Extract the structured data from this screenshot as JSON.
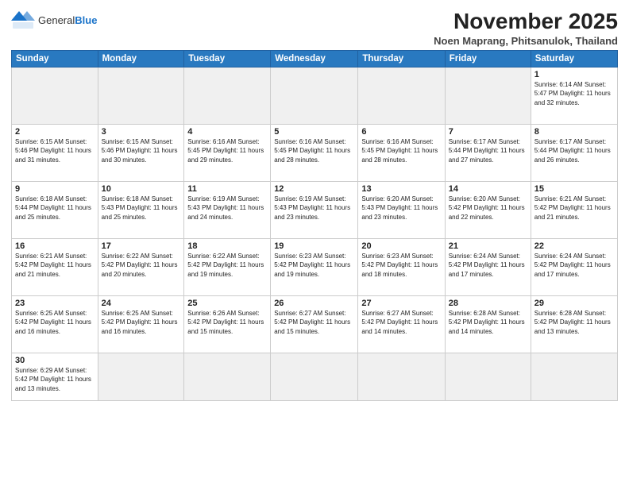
{
  "header": {
    "logo_general": "General",
    "logo_blue": "Blue",
    "month_title": "November 2025",
    "location": "Noen Maprang, Phitsanulok, Thailand"
  },
  "weekdays": [
    "Sunday",
    "Monday",
    "Tuesday",
    "Wednesday",
    "Thursday",
    "Friday",
    "Saturday"
  ],
  "weeks": [
    [
      {
        "day": "",
        "info": ""
      },
      {
        "day": "",
        "info": ""
      },
      {
        "day": "",
        "info": ""
      },
      {
        "day": "",
        "info": ""
      },
      {
        "day": "",
        "info": ""
      },
      {
        "day": "",
        "info": ""
      },
      {
        "day": "1",
        "info": "Sunrise: 6:14 AM\nSunset: 5:47 PM\nDaylight: 11 hours\nand 32 minutes."
      }
    ],
    [
      {
        "day": "2",
        "info": "Sunrise: 6:15 AM\nSunset: 5:46 PM\nDaylight: 11 hours\nand 31 minutes."
      },
      {
        "day": "3",
        "info": "Sunrise: 6:15 AM\nSunset: 5:46 PM\nDaylight: 11 hours\nand 30 minutes."
      },
      {
        "day": "4",
        "info": "Sunrise: 6:16 AM\nSunset: 5:45 PM\nDaylight: 11 hours\nand 29 minutes."
      },
      {
        "day": "5",
        "info": "Sunrise: 6:16 AM\nSunset: 5:45 PM\nDaylight: 11 hours\nand 28 minutes."
      },
      {
        "day": "6",
        "info": "Sunrise: 6:16 AM\nSunset: 5:45 PM\nDaylight: 11 hours\nand 28 minutes."
      },
      {
        "day": "7",
        "info": "Sunrise: 6:17 AM\nSunset: 5:44 PM\nDaylight: 11 hours\nand 27 minutes."
      },
      {
        "day": "8",
        "info": "Sunrise: 6:17 AM\nSunset: 5:44 PM\nDaylight: 11 hours\nand 26 minutes."
      }
    ],
    [
      {
        "day": "9",
        "info": "Sunrise: 6:18 AM\nSunset: 5:44 PM\nDaylight: 11 hours\nand 25 minutes."
      },
      {
        "day": "10",
        "info": "Sunrise: 6:18 AM\nSunset: 5:43 PM\nDaylight: 11 hours\nand 25 minutes."
      },
      {
        "day": "11",
        "info": "Sunrise: 6:19 AM\nSunset: 5:43 PM\nDaylight: 11 hours\nand 24 minutes."
      },
      {
        "day": "12",
        "info": "Sunrise: 6:19 AM\nSunset: 5:43 PM\nDaylight: 11 hours\nand 23 minutes."
      },
      {
        "day": "13",
        "info": "Sunrise: 6:20 AM\nSunset: 5:43 PM\nDaylight: 11 hours\nand 23 minutes."
      },
      {
        "day": "14",
        "info": "Sunrise: 6:20 AM\nSunset: 5:42 PM\nDaylight: 11 hours\nand 22 minutes."
      },
      {
        "day": "15",
        "info": "Sunrise: 6:21 AM\nSunset: 5:42 PM\nDaylight: 11 hours\nand 21 minutes."
      }
    ],
    [
      {
        "day": "16",
        "info": "Sunrise: 6:21 AM\nSunset: 5:42 PM\nDaylight: 11 hours\nand 21 minutes."
      },
      {
        "day": "17",
        "info": "Sunrise: 6:22 AM\nSunset: 5:42 PM\nDaylight: 11 hours\nand 20 minutes."
      },
      {
        "day": "18",
        "info": "Sunrise: 6:22 AM\nSunset: 5:42 PM\nDaylight: 11 hours\nand 19 minutes."
      },
      {
        "day": "19",
        "info": "Sunrise: 6:23 AM\nSunset: 5:42 PM\nDaylight: 11 hours\nand 19 minutes."
      },
      {
        "day": "20",
        "info": "Sunrise: 6:23 AM\nSunset: 5:42 PM\nDaylight: 11 hours\nand 18 minutes."
      },
      {
        "day": "21",
        "info": "Sunrise: 6:24 AM\nSunset: 5:42 PM\nDaylight: 11 hours\nand 17 minutes."
      },
      {
        "day": "22",
        "info": "Sunrise: 6:24 AM\nSunset: 5:42 PM\nDaylight: 11 hours\nand 17 minutes."
      }
    ],
    [
      {
        "day": "23",
        "info": "Sunrise: 6:25 AM\nSunset: 5:42 PM\nDaylight: 11 hours\nand 16 minutes."
      },
      {
        "day": "24",
        "info": "Sunrise: 6:25 AM\nSunset: 5:42 PM\nDaylight: 11 hours\nand 16 minutes."
      },
      {
        "day": "25",
        "info": "Sunrise: 6:26 AM\nSunset: 5:42 PM\nDaylight: 11 hours\nand 15 minutes."
      },
      {
        "day": "26",
        "info": "Sunrise: 6:27 AM\nSunset: 5:42 PM\nDaylight: 11 hours\nand 15 minutes."
      },
      {
        "day": "27",
        "info": "Sunrise: 6:27 AM\nSunset: 5:42 PM\nDaylight: 11 hours\nand 14 minutes."
      },
      {
        "day": "28",
        "info": "Sunrise: 6:28 AM\nSunset: 5:42 PM\nDaylight: 11 hours\nand 14 minutes."
      },
      {
        "day": "29",
        "info": "Sunrise: 6:28 AM\nSunset: 5:42 PM\nDaylight: 11 hours\nand 13 minutes."
      }
    ],
    [
      {
        "day": "30",
        "info": "Sunrise: 6:29 AM\nSunset: 5:42 PM\nDaylight: 11 hours\nand 13 minutes."
      },
      {
        "day": "",
        "info": ""
      },
      {
        "day": "",
        "info": ""
      },
      {
        "day": "",
        "info": ""
      },
      {
        "day": "",
        "info": ""
      },
      {
        "day": "",
        "info": ""
      },
      {
        "day": "",
        "info": ""
      }
    ]
  ]
}
